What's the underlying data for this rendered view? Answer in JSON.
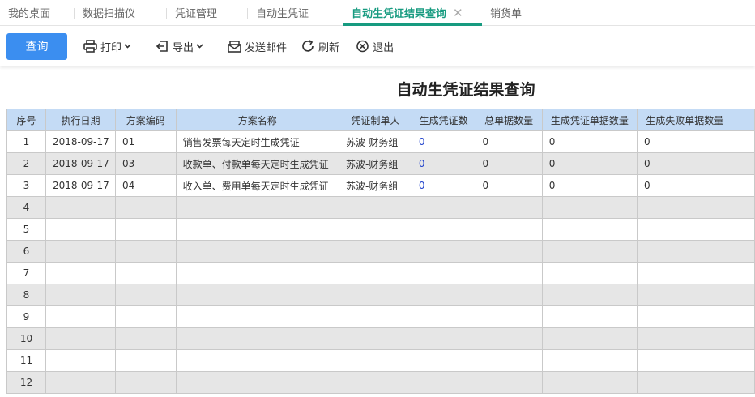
{
  "tabs": [
    {
      "label": "我的桌面",
      "active": false
    },
    {
      "label": "数据扫描仪",
      "active": false
    },
    {
      "label": "凭证管理",
      "active": false
    },
    {
      "label": "自动生凭证",
      "active": false
    },
    {
      "label": "自动生凭证结果查询",
      "active": true
    },
    {
      "label": "销货单",
      "active": false
    }
  ],
  "tab_close_glyph": "✕",
  "toolbar": {
    "query": "查询",
    "print": "打印",
    "export": "导出",
    "send_mail": "发送邮件",
    "refresh": "刷新",
    "exit": "退出"
  },
  "page_title": "自动生凭证结果查询",
  "table": {
    "headers": [
      "序号",
      "执行日期",
      "方案编码",
      "方案名称",
      "凭证制单人",
      "生成凭证数",
      "总单据数量",
      "生成凭证单据数量",
      "生成失败单据数量"
    ],
    "rows": [
      [
        "1",
        "2018-09-17",
        "01",
        "销售发票每天定时生成凭证",
        "苏波-财务组",
        "0",
        "0",
        "0",
        "0"
      ],
      [
        "2",
        "2018-09-17",
        "03",
        "收款单、付款单每天定时生成凭证",
        "苏波-财务组",
        "0",
        "0",
        "0",
        "0"
      ],
      [
        "3",
        "2018-09-17",
        "04",
        "收入单、费用单每天定时生成凭证",
        "苏波-财务组",
        "0",
        "0",
        "0",
        "0"
      ],
      [
        "4",
        "",
        "",
        "",
        "",
        "",
        "",
        "",
        ""
      ],
      [
        "5",
        "",
        "",
        "",
        "",
        "",
        "",
        "",
        ""
      ],
      [
        "6",
        "",
        "",
        "",
        "",
        "",
        "",
        "",
        ""
      ],
      [
        "7",
        "",
        "",
        "",
        "",
        "",
        "",
        "",
        ""
      ],
      [
        "8",
        "",
        "",
        "",
        "",
        "",
        "",
        "",
        ""
      ],
      [
        "9",
        "",
        "",
        "",
        "",
        "",
        "",
        "",
        ""
      ],
      [
        "10",
        "",
        "",
        "",
        "",
        "",
        "",
        "",
        ""
      ],
      [
        "11",
        "",
        "",
        "",
        "",
        "",
        "",
        "",
        ""
      ],
      [
        "12",
        "",
        "",
        "",
        "",
        "",
        "",
        "",
        ""
      ]
    ]
  },
  "colors": {
    "accent": "#179b80",
    "primary_button": "#3b8ef0",
    "header_bg": "#c4dbf5",
    "link_value": "#2244cc"
  }
}
